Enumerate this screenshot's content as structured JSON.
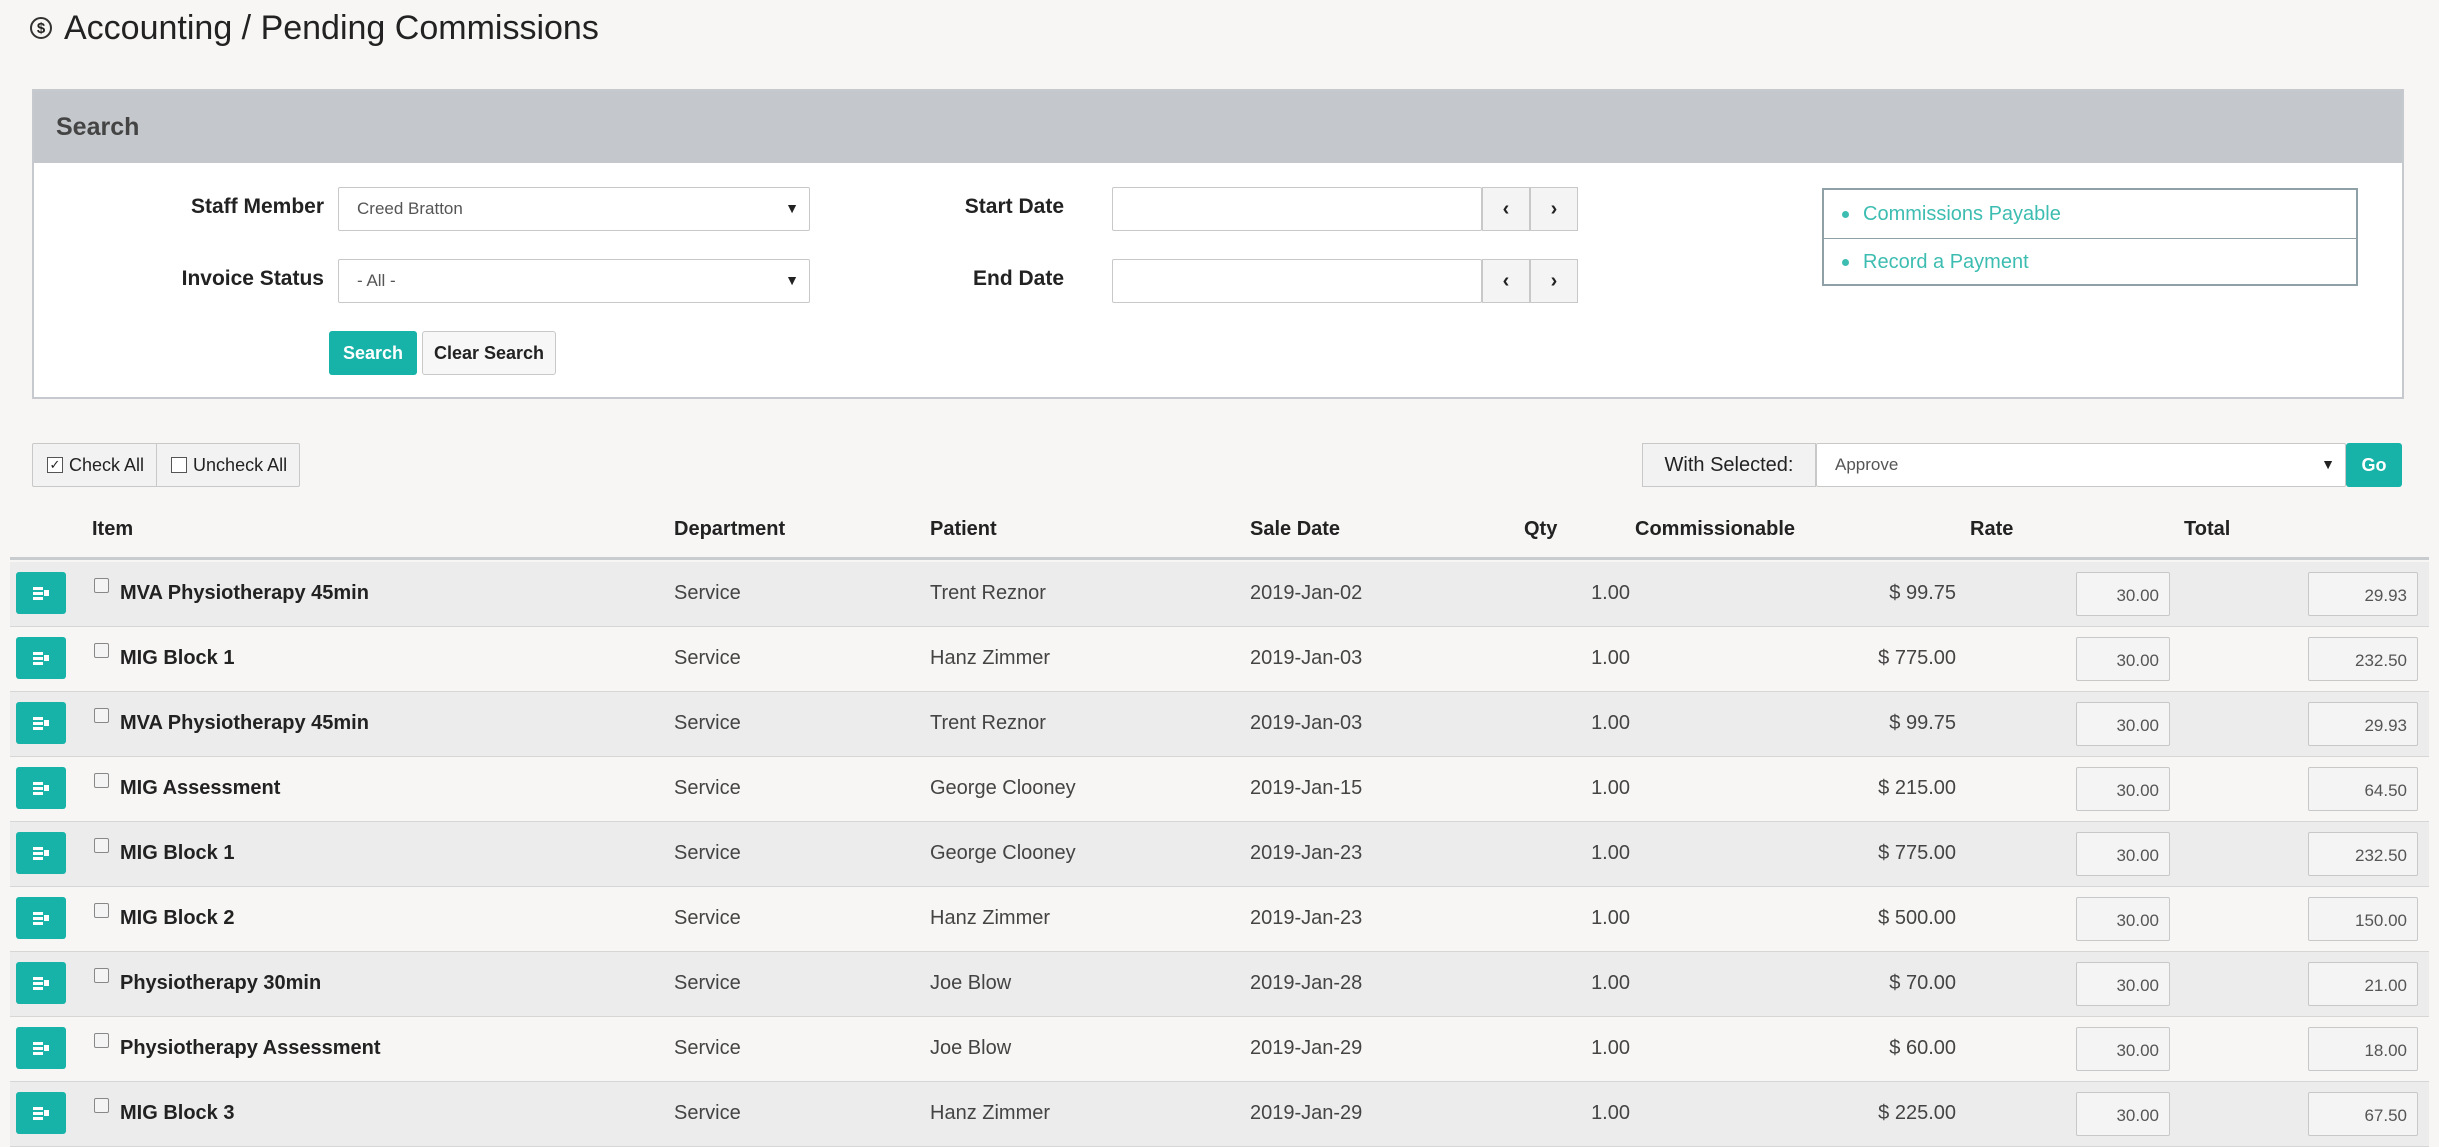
{
  "page": {
    "title": "Accounting / Pending Commissions",
    "title_icon": "dollar-circle-icon"
  },
  "search": {
    "header": "Search",
    "staff_member_label": "Staff Member",
    "staff_member_value": "Creed Bratton",
    "invoice_status_label": "Invoice Status",
    "invoice_status_value": "- All -",
    "start_date_label": "Start Date",
    "start_date_value": "",
    "end_date_label": "End Date",
    "end_date_value": "",
    "search_button": "Search",
    "clear_button": "Clear Search",
    "prev_symbol": "‹",
    "next_symbol": "›"
  },
  "links": [
    "Commissions Payable",
    "Record a Payment"
  ],
  "toolbar": {
    "check_all": "Check All",
    "uncheck_all": "Uncheck All",
    "with_selected_label": "With Selected:",
    "with_selected_value": "Approve",
    "go_button": "Go"
  },
  "table": {
    "headers": {
      "item": "Item",
      "department": "Department",
      "patient": "Patient",
      "sale_date": "Sale Date",
      "qty": "Qty",
      "commissionable": "Commissionable",
      "rate": "Rate",
      "total": "Total"
    },
    "rows": [
      {
        "item": "MVA Physiotherapy 45min",
        "department": "Service",
        "patient": "Trent Reznor",
        "sale_date": "2019-Jan-02",
        "qty": "1.00",
        "commissionable": "$ 99.75",
        "rate": "30.00",
        "total": "29.93"
      },
      {
        "item": "MIG Block 1",
        "department": "Service",
        "patient": "Hanz Zimmer",
        "sale_date": "2019-Jan-03",
        "qty": "1.00",
        "commissionable": "$ 775.00",
        "rate": "30.00",
        "total": "232.50"
      },
      {
        "item": "MVA Physiotherapy 45min",
        "department": "Service",
        "patient": "Trent Reznor",
        "sale_date": "2019-Jan-03",
        "qty": "1.00",
        "commissionable": "$ 99.75",
        "rate": "30.00",
        "total": "29.93"
      },
      {
        "item": "MIG Assessment",
        "department": "Service",
        "patient": "George Clooney",
        "sale_date": "2019-Jan-15",
        "qty": "1.00",
        "commissionable": "$ 215.00",
        "rate": "30.00",
        "total": "64.50"
      },
      {
        "item": "MIG Block 1",
        "department": "Service",
        "patient": "George Clooney",
        "sale_date": "2019-Jan-23",
        "qty": "1.00",
        "commissionable": "$ 775.00",
        "rate": "30.00",
        "total": "232.50"
      },
      {
        "item": "MIG Block 2",
        "department": "Service",
        "patient": "Hanz Zimmer",
        "sale_date": "2019-Jan-23",
        "qty": "1.00",
        "commissionable": "$ 500.00",
        "rate": "30.00",
        "total": "150.00"
      },
      {
        "item": "Physiotherapy 30min",
        "department": "Service",
        "patient": "Joe Blow",
        "sale_date": "2019-Jan-28",
        "qty": "1.00",
        "commissionable": "$ 70.00",
        "rate": "30.00",
        "total": "21.00"
      },
      {
        "item": "Physiotherapy Assessment",
        "department": "Service",
        "patient": "Joe Blow",
        "sale_date": "2019-Jan-29",
        "qty": "1.00",
        "commissionable": "$ 60.00",
        "rate": "30.00",
        "total": "18.00"
      },
      {
        "item": "MIG Block 3",
        "department": "Service",
        "patient": "Hanz Zimmer",
        "sale_date": "2019-Jan-29",
        "qty": "1.00",
        "commissionable": "$ 225.00",
        "rate": "30.00",
        "total": "67.50"
      }
    ]
  },
  "colors": {
    "accent": "#17b3a8",
    "link": "#3dbdb1",
    "panel_header": "#c4c7cb"
  }
}
